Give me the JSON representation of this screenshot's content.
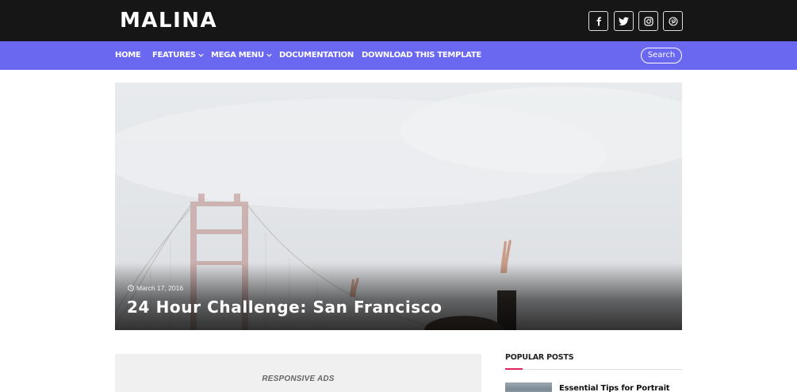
{
  "brand": {
    "logo_text": "MALINA"
  },
  "social": [
    {
      "icon": "facebook-icon"
    },
    {
      "icon": "twitter-icon"
    },
    {
      "icon": "instagram-icon"
    },
    {
      "icon": "pinterest-icon"
    }
  ],
  "nav": {
    "items": [
      {
        "label": "HOME",
        "has_dropdown": false
      },
      {
        "label": "FEATURES",
        "has_dropdown": true
      },
      {
        "label": "MEGA MENU",
        "has_dropdown": true
      },
      {
        "label": "DOCUMENTATION",
        "has_dropdown": false
      },
      {
        "label": "DOWNLOAD THIS TEMPLATE",
        "has_dropdown": false
      }
    ],
    "search_label": "Search"
  },
  "featured": {
    "date": "March 17, 2016",
    "title": "24 Hour Challenge: San Francisco"
  },
  "ads": {
    "label": "RESPONSIVE ADS"
  },
  "sidebar": {
    "popular_heading": "POPULAR POSTS",
    "posts": [
      {
        "title": "Essential Tips for Portrait"
      }
    ]
  },
  "colors": {
    "topbar": "#161616",
    "nav_bg": "#6a67f0",
    "accent": "#e0245e"
  }
}
